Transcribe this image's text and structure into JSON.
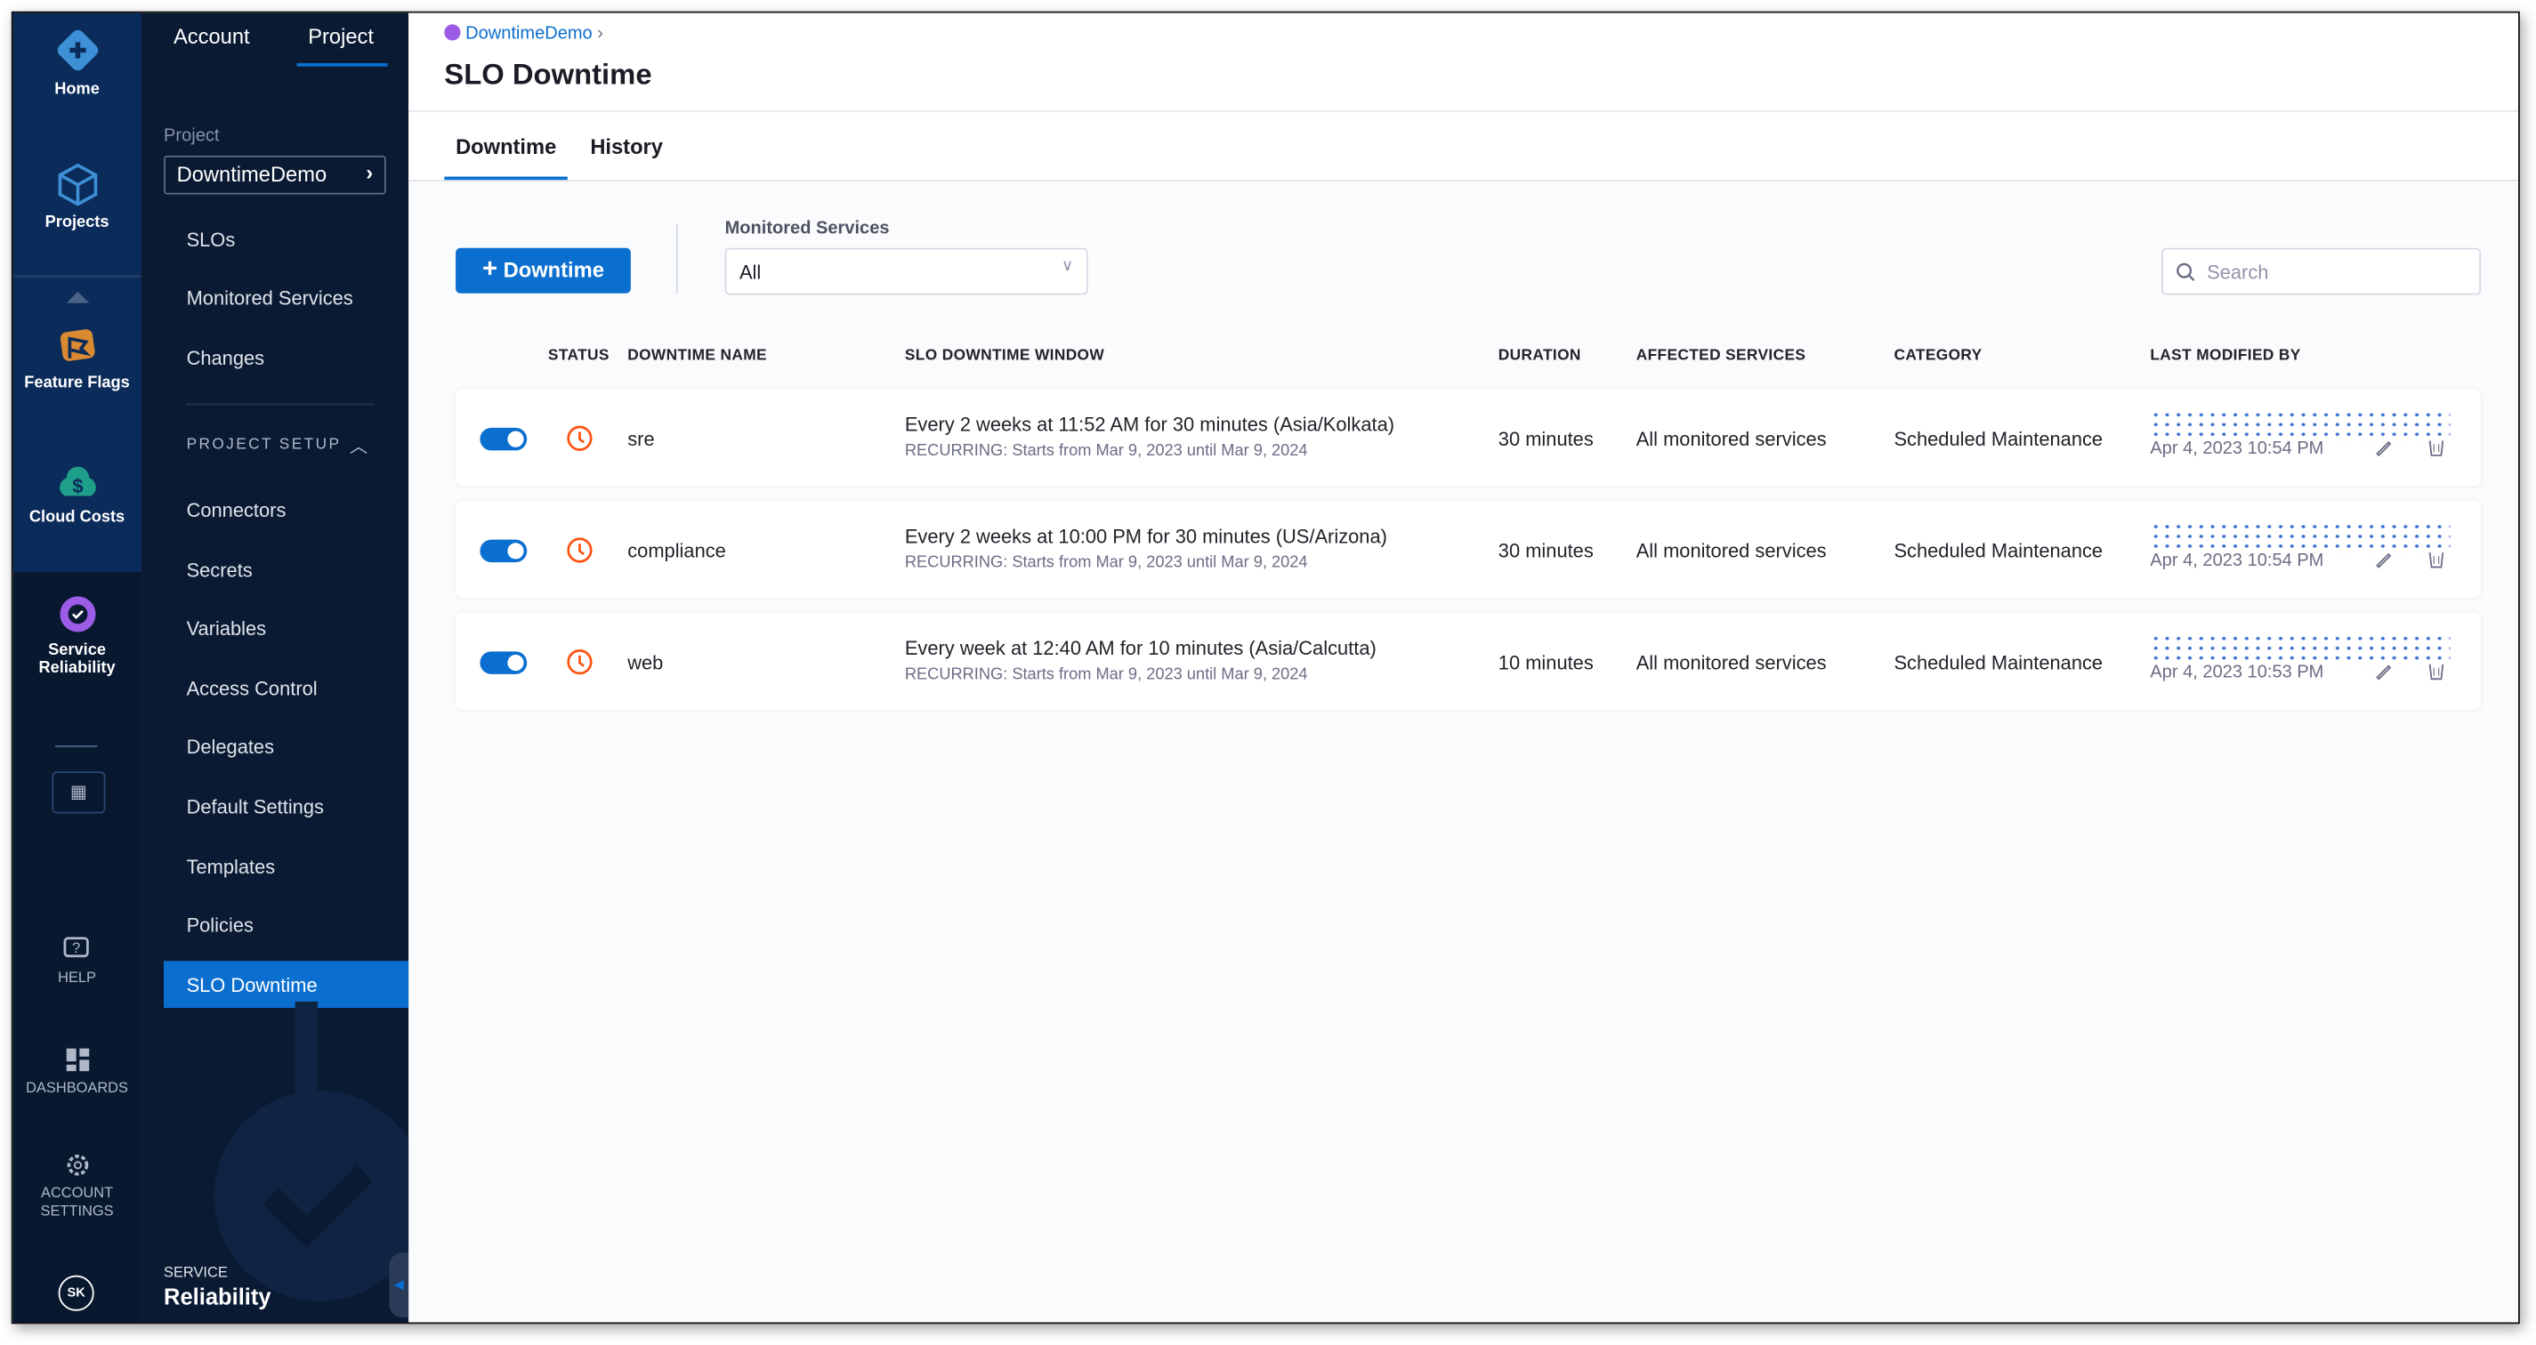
{
  "rail": {
    "items": [
      {
        "label": "Home",
        "icon": "home-icon"
      },
      {
        "label": "Projects",
        "icon": "projects-icon"
      },
      {
        "label": "Feature Flags",
        "icon": "feature-flags-icon"
      },
      {
        "label": "Cloud Costs",
        "icon": "cloud-costs-icon"
      },
      {
        "label": "Service Reliability",
        "icon": "service-reliability-icon"
      }
    ],
    "bottom": [
      {
        "label": "HELP",
        "icon": "help-icon"
      },
      {
        "label": "DASHBOARDS",
        "icon": "dashboards-icon"
      },
      {
        "label": "ACCOUNT SETTINGS",
        "icon": "gear-icon"
      }
    ],
    "avatar": "SK"
  },
  "nav": {
    "tabs": [
      "Account",
      "Project"
    ],
    "project_label": "Project",
    "project_name": "DowntimeDemo",
    "items": [
      "SLOs",
      "Monitored Services",
      "Changes"
    ],
    "section": "PROJECT SETUP",
    "setup_items": [
      "Connectors",
      "Secrets",
      "Variables",
      "Access Control",
      "Delegates",
      "Default Settings",
      "Templates",
      "Policies",
      "SLO Downtime"
    ],
    "module_small": "SERVICE",
    "module_big": "Reliability"
  },
  "header": {
    "breadcrumb": "DowntimeDemo",
    "title": "SLO Downtime"
  },
  "tabs": [
    "Downtime",
    "History"
  ],
  "toolbar": {
    "add_label": "Downtime",
    "filter_label": "Monitored Services",
    "filter_value": "All",
    "search_placeholder": "Search"
  },
  "table": {
    "columns": [
      "STATUS",
      "DOWNTIME NAME",
      "SLO DOWNTIME WINDOW",
      "DURATION",
      "AFFECTED SERVICES",
      "CATEGORY",
      "LAST MODIFIED BY"
    ],
    "rows": [
      {
        "enabled": true,
        "name": "sre",
        "window": "Every 2 weeks at 11:52 AM for 30 minutes (Asia/Kolkata)",
        "recurring": "RECURRING: Starts from Mar 9, 2023 until Mar 9, 2024",
        "duration": "30 minutes",
        "affected": "All monitored services",
        "category": "Scheduled Maintenance",
        "modified": "Apr 4, 2023 10:54 PM"
      },
      {
        "enabled": true,
        "name": "compliance",
        "window": "Every 2 weeks at 10:00 PM for 30 minutes (US/Arizona)",
        "recurring": "RECURRING: Starts from Mar 9, 2023 until Mar 9, 2024",
        "duration": "30 minutes",
        "affected": "All monitored services",
        "category": "Scheduled Maintenance",
        "modified": "Apr 4, 2023 10:54 PM"
      },
      {
        "enabled": true,
        "name": "web",
        "window": "Every week at 12:40 AM for 10 minutes (Asia/Calcutta)",
        "recurring": "RECURRING: Starts from Mar 9, 2023 until Mar 9, 2024",
        "duration": "10 minutes",
        "affected": "All monitored services",
        "category": "Scheduled Maintenance",
        "modified": "Apr 4, 2023 10:53 PM"
      }
    ]
  },
  "colors": {
    "accent": "#0b6fd0",
    "status_clock": "#ff5310",
    "rail": "#0b2b5a",
    "nav": "#0a1a33"
  }
}
